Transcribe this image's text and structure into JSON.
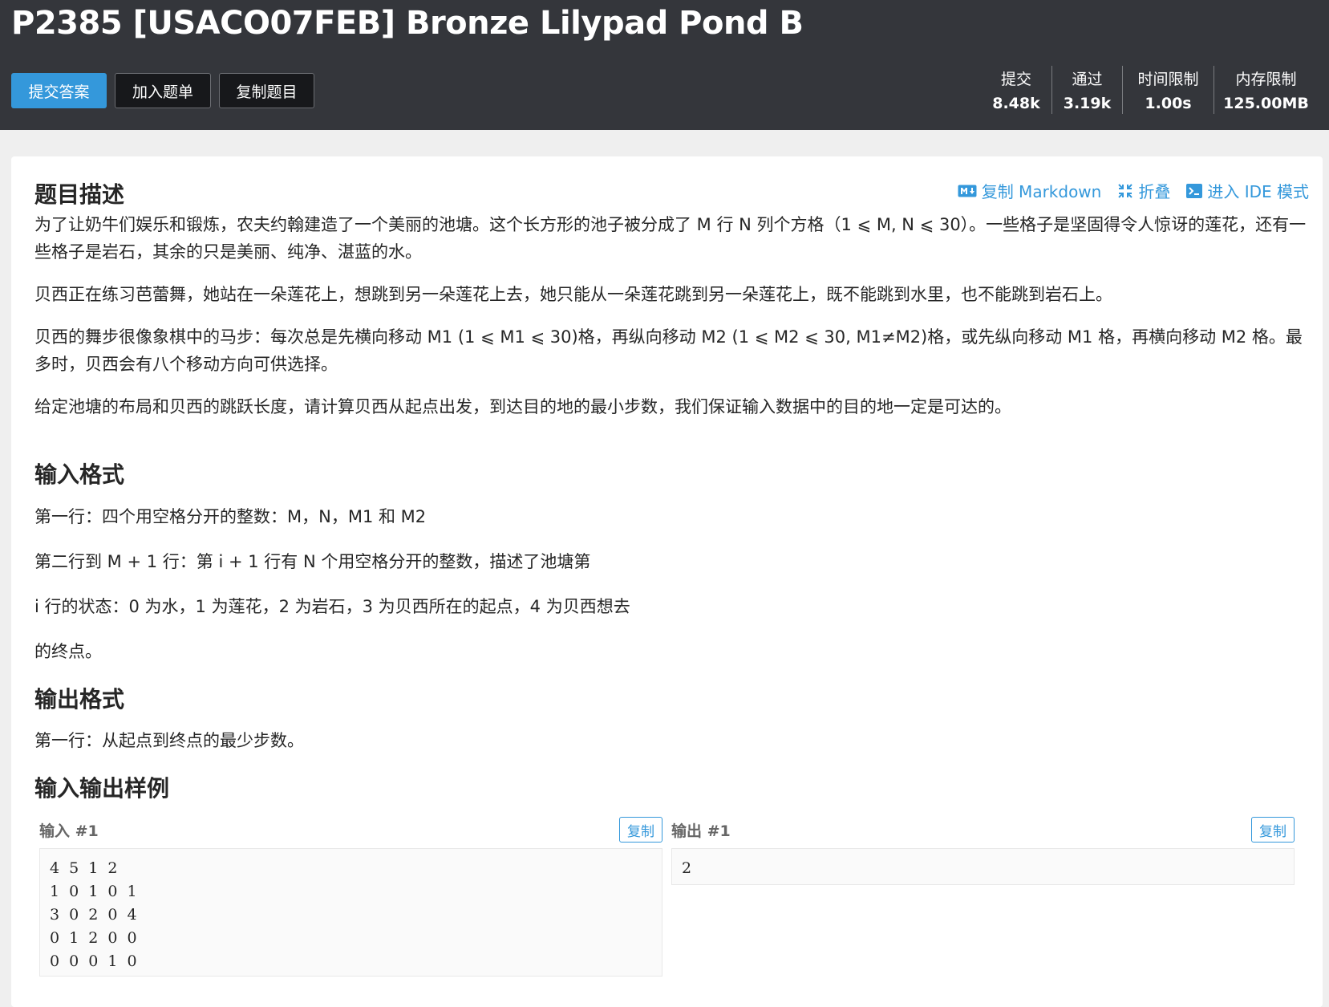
{
  "header": {
    "title": "P2385 [USACO07FEB] Bronze Lilypad Pond B",
    "buttons": {
      "submit": "提交答案",
      "add_to_list": "加入题单",
      "copy_problem": "复制题目"
    },
    "stats": [
      {
        "label": "提交",
        "value": "8.48k"
      },
      {
        "label": "通过",
        "value": "3.19k"
      },
      {
        "label": "时间限制",
        "value": "1.00s"
      },
      {
        "label": "内存限制",
        "value": "125.00MB"
      }
    ]
  },
  "toolbar": {
    "copy_markdown": "复制 Markdown",
    "fold": "折叠",
    "ide_mode": "进入 IDE 模式"
  },
  "description": {
    "heading": "题目描述",
    "paragraphs": [
      "为了让奶牛们娱乐和锻炼，农夫约翰建造了一个美丽的池塘。这个长方形的池子被分成了 M 行 N 列个方格（1 ⩽ M, N ⩽ 30）。一些格子是坚固得令人惊讶的莲花，还有一些格子是岩石，其余的只是美丽、纯净、湛蓝的水。",
      "贝西正在练习芭蕾舞，她站在一朵莲花上，想跳到另一朵莲花上去，她只能从一朵莲花跳到另一朵莲花上，既不能跳到水里，也不能跳到岩石上。",
      "贝西的舞步很像象棋中的马步：每次总是先横向移动 M1 (1 ⩽ M1 ⩽ 30)格，再纵向移动 M2 (1 ⩽ M2 ⩽ 30, M1≠M2)格，或先纵向移动 M1 格，再横向移动 M2 格。最多时，贝西会有八个移动方向可供选择。",
      "给定池塘的布局和贝西的跳跃长度，请计算贝西从起点出发，到达目的地的最小步数，我们保证输入数据中的目的地一定是可达的。"
    ]
  },
  "input_format": {
    "heading": "输入格式",
    "lines": [
      "第一行：四个用空格分开的整数：M，N，M1 和 M2",
      "第二行到 M + 1 行：第 i + 1 行有 N 个用空格分开的整数，描述了池塘第",
      "i 行的状态：0 为水，1 为莲花，2 为岩石，3 为贝西所在的起点，4 为贝西想去",
      "的终点。"
    ]
  },
  "output_format": {
    "heading": "输出格式",
    "lines": [
      "第一行：从起点到终点的最少步数。"
    ]
  },
  "samples": {
    "heading": "输入输出样例",
    "input_label": "输入 #1",
    "output_label": "输出 #1",
    "copy_label": "复制",
    "input_lines": [
      "4 5 1 2",
      "1 0 1 0 1",
      "3 0 2 0 4",
      "0 1 2 0 0",
      "0 0 0 1 0"
    ],
    "output_lines": [
      "2"
    ]
  },
  "colors": {
    "header_bg": "#34363b",
    "primary": "#3498db",
    "page_bg": "#efefef"
  }
}
